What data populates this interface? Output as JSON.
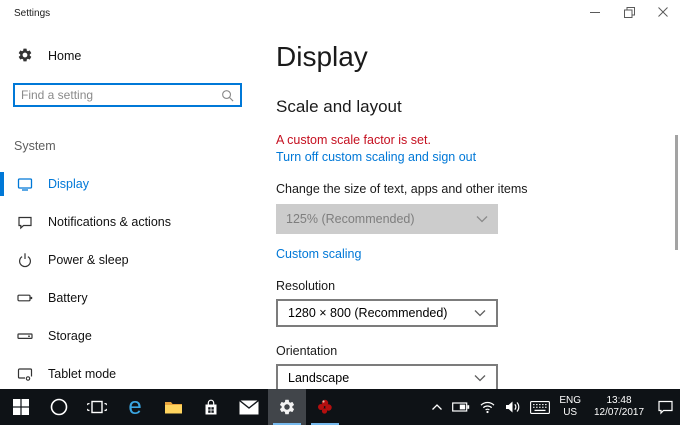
{
  "window": {
    "title": "Settings"
  },
  "sidebar": {
    "home_label": "Home",
    "search_placeholder": "Find a setting",
    "group_label": "System",
    "items": [
      {
        "label": "Display",
        "active": true
      },
      {
        "label": "Notifications & actions",
        "active": false
      },
      {
        "label": "Power & sleep",
        "active": false
      },
      {
        "label": "Battery",
        "active": false
      },
      {
        "label": "Storage",
        "active": false
      },
      {
        "label": "Tablet mode",
        "active": false
      }
    ]
  },
  "main": {
    "title": "Display",
    "section_title": "Scale and layout",
    "warning": "A custom scale factor is set.",
    "signout_link": "Turn off custom scaling and sign out",
    "scale_label": "Change the size of text, apps and other items",
    "scale_value": "125% (Recommended)",
    "custom_scaling_link": "Custom scaling",
    "resolution_label": "Resolution",
    "resolution_value": "1280 × 800 (Recommended)",
    "orientation_label": "Orientation",
    "orientation_value": "Landscape"
  },
  "taskbar": {
    "edge_glyph": "e",
    "app_icons": [
      "start-icon",
      "cortana-icon",
      "task-view-icon",
      "edge-icon",
      "file-explorer-icon",
      "store-icon",
      "mail-icon",
      "settings-icon",
      "red-app-icon"
    ],
    "tray_icons": [
      "chevron-up-icon",
      "battery-icon",
      "wifi-icon",
      "volume-icon",
      "keyboard-icon",
      "action-center-icon"
    ],
    "tray": {
      "language_primary": "ENG",
      "language_secondary": "US",
      "time": "13:48",
      "date": "12/07/2017"
    }
  },
  "colors": {
    "accent": "#0078d7",
    "warning": "#c50f1f",
    "taskbar_bg": "#0e1216",
    "active_tile": "#41454a",
    "running_underline": "#76b9ed"
  }
}
